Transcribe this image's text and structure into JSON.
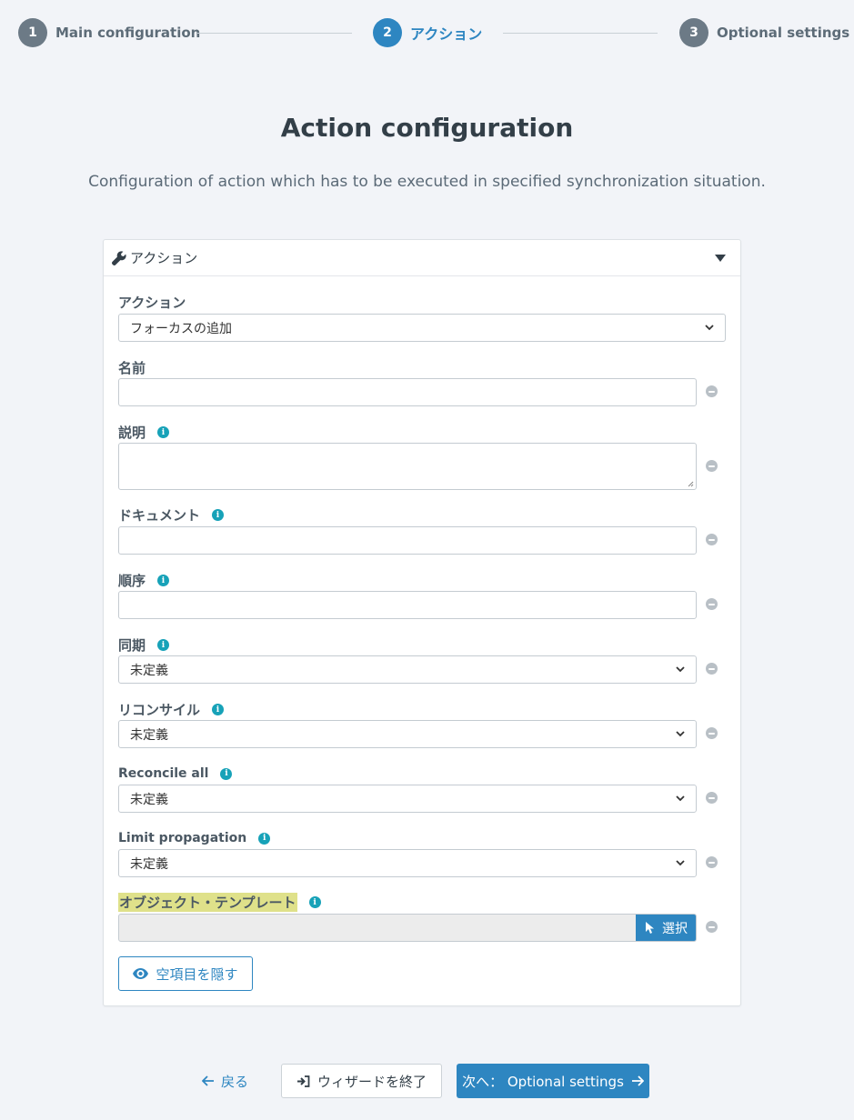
{
  "stepper": {
    "steps": [
      {
        "number": "1",
        "label": "Main configuration",
        "state": "completed"
      },
      {
        "number": "2",
        "label": "アクション",
        "state": "active"
      },
      {
        "number": "3",
        "label": "Optional settings",
        "state": "pending"
      }
    ]
  },
  "page": {
    "title": "Action configuration",
    "description": "Configuration of action which has to be executed in specified synchronization situation."
  },
  "panel": {
    "title": "アクション",
    "header_icon": "wrench-icon",
    "toggle_icon": "caret-down-icon",
    "fields": {
      "action": {
        "label": "アクション",
        "value": "フォーカスの追加"
      },
      "name": {
        "label": "名前",
        "value": ""
      },
      "description": {
        "label": "説明",
        "value": ""
      },
      "documentation": {
        "label": "ドキュメント",
        "value": ""
      },
      "order": {
        "label": "順序",
        "value": ""
      },
      "synchronize": {
        "label": "同期",
        "value": "未定義"
      },
      "reconcile": {
        "label": "リコンサイル",
        "value": "未定義"
      },
      "reconcile_all": {
        "label": "Reconcile all",
        "value": "未定義"
      },
      "limit_propagation": {
        "label": "Limit propagation",
        "value": "未定義"
      },
      "object_template": {
        "label": "オブジェクト・テンプレート",
        "value": "",
        "button_label": "選択"
      }
    },
    "hide_empty_button": "空項目を隠す"
  },
  "footer": {
    "back_label": "戻る",
    "exit_label": "ウィザードを終了",
    "next_label": "次へ： Optional settings"
  },
  "colors": {
    "accent": "#2e86c1",
    "info": "#17a2b8",
    "highlight": "#dfe18a",
    "background": "#f2f4f8"
  }
}
